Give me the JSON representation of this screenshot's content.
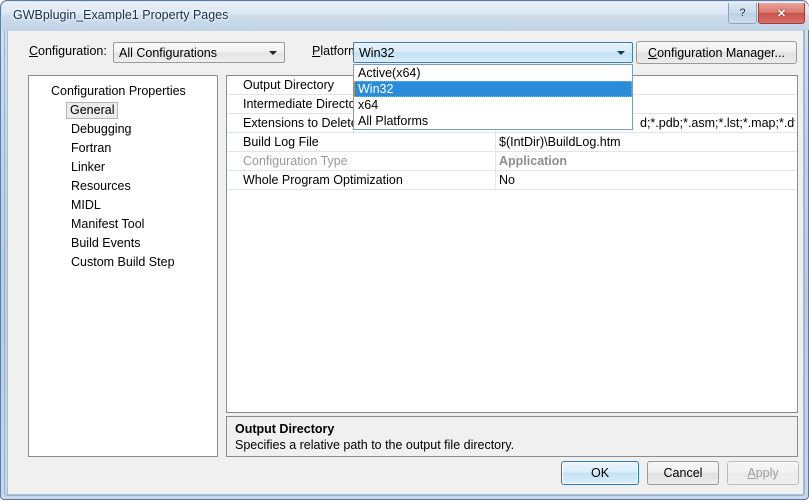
{
  "window": {
    "title": "GWBplugin_Example1 Property Pages",
    "help_button": "?",
    "close_button": "✕"
  },
  "toolbar": {
    "configuration_label": "Configuration:",
    "configuration_value": "All Configurations",
    "platform_label": "Platform:",
    "platform_value": "Win32",
    "configuration_manager_label": "Configuration Manager..."
  },
  "platform_dropdown": {
    "open": true,
    "selected": "Win32",
    "options": [
      "Active(x64)",
      "Win32",
      "x64",
      "All Platforms"
    ]
  },
  "tree": {
    "root": "Configuration Properties",
    "selected": "General",
    "items": [
      "General",
      "Debugging",
      "Fortran",
      "Linker",
      "Resources",
      "MIDL",
      "Manifest Tool",
      "Build Events",
      "Custom Build Step"
    ]
  },
  "grid": {
    "rows": [
      {
        "name": "Output Directory",
        "value": "",
        "dim": false
      },
      {
        "name": "Intermediate Directory",
        "value": "",
        "dim": false
      },
      {
        "name": "Extensions to Delete on Clean",
        "value": "d;*.pdb;*.asm;*.lst;*.map;*.dyn;*",
        "dim": false
      },
      {
        "name": "Build Log File",
        "value": "$(IntDir)\\BuildLog.htm",
        "dim": false
      },
      {
        "name": "Configuration Type",
        "value": "Application",
        "dim": true
      },
      {
        "name": "Whole Program Optimization",
        "value": "No",
        "dim": false
      }
    ]
  },
  "description": {
    "title": "Output Directory",
    "text": "Specifies a relative path to the output file directory."
  },
  "buttons": {
    "ok": "OK",
    "cancel": "Cancel",
    "apply": "Apply"
  },
  "colors": {
    "selection_blue": "#2a8bd8",
    "accent_border": "#3c7fb1",
    "close_red": "#c8544a",
    "dialog_bg": "#f0f0f0"
  }
}
